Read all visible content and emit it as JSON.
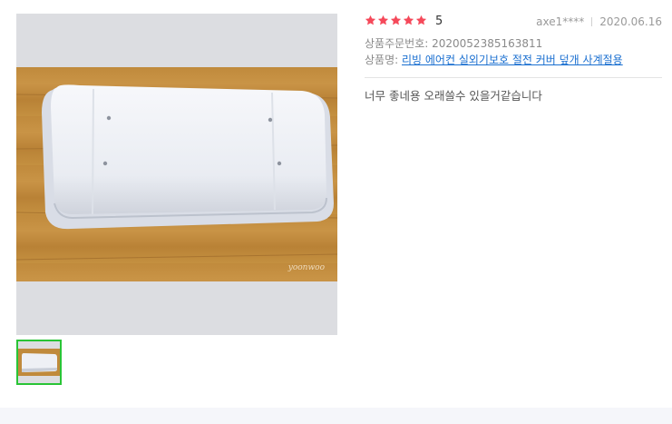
{
  "rating": {
    "value": 5,
    "max": 5,
    "star_color": "#f5495a"
  },
  "reviewer": {
    "name": "axe1****",
    "date": "2020.06.16"
  },
  "order": {
    "label": "상품주문번호:",
    "number": "2020052385163811"
  },
  "product": {
    "label": "상품명:",
    "name": "리빙 에어컨 실외기보호 절전 커버 덮개 사계절용"
  },
  "review": {
    "text": "너무 좋네용 오래쓸수 있을거같습니다"
  },
  "photo": {
    "watermark": "yoonwoo"
  },
  "colors": {
    "accent_link": "#1a6fd0",
    "thumb_border": "#29c436",
    "photo_background": "#dcdde1"
  }
}
